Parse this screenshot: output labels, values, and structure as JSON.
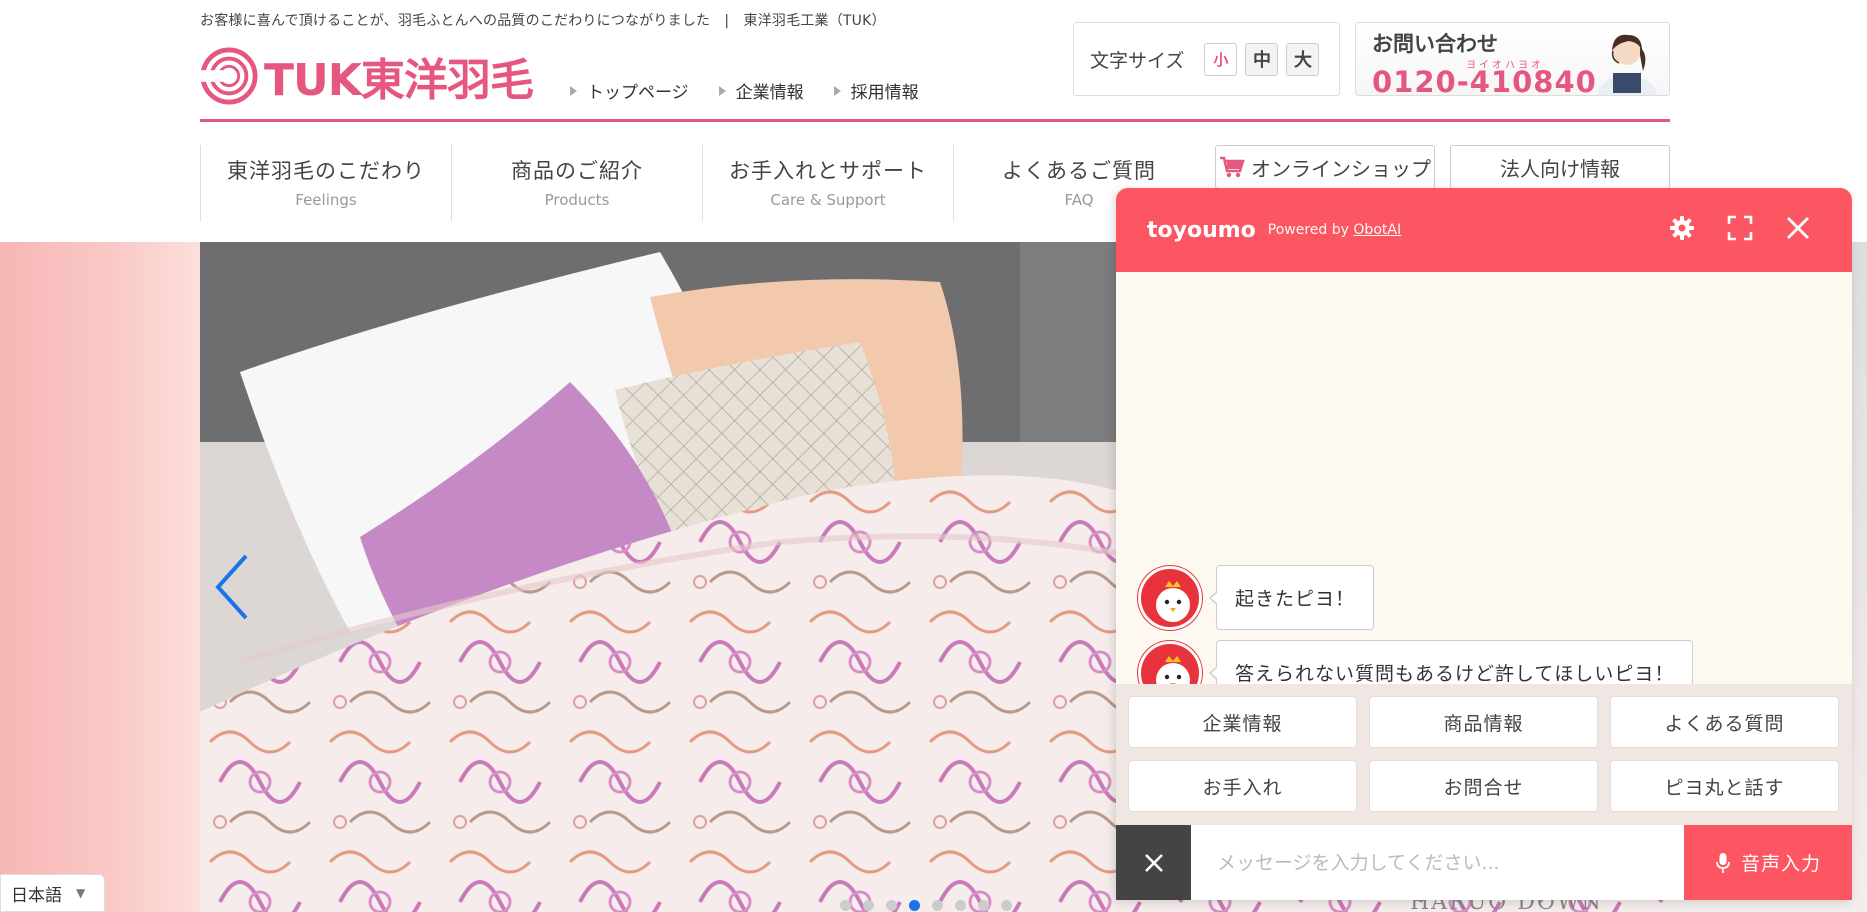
{
  "header": {
    "tagline": "お客様に喜んで頂けることが、羽毛ふとんへの品質のこだわりにつながりました　|　東洋羽毛工業（TUK）",
    "logo_text": "TUK東洋羽毛",
    "top_links": [
      "トップページ",
      "企業情報",
      "採用情報"
    ],
    "font_size": {
      "label": "文字サイズ",
      "options": [
        "小",
        "中",
        "大"
      ]
    },
    "contact": {
      "title": "お問い合わせ",
      "kana": "ヨイオハヨオ",
      "tel": "0120-410840"
    }
  },
  "nav": {
    "items": [
      {
        "jp": "東洋羽毛のこだわり",
        "en": "Feelings"
      },
      {
        "jp": "商品のご紹介",
        "en": "Products"
      },
      {
        "jp": "お手入れとサポート",
        "en": "Care & Support"
      },
      {
        "jp": "よくあるご質問",
        "en": "FAQ"
      }
    ],
    "shop": "オンラインショップ",
    "corporate": "法人向け情報"
  },
  "hero": {
    "watermark": "HARUO DOWN",
    "dots_count": 8,
    "active_dot": 3
  },
  "language": {
    "selected": "日本語"
  },
  "chat": {
    "brand": "toyoumo",
    "powered_prefix": "Powered by",
    "powered_link": "ObotAI",
    "messages": [
      "起きたピヨ！",
      "答えられない質問もあるけど許してほしいピヨ！"
    ],
    "quick_replies": [
      "企業情報",
      "商品情報",
      "よくある質問",
      "お手入れ",
      "お問合せ",
      "ピヨ丸と話す"
    ],
    "input_placeholder": "メッセージを入力してください...",
    "voice_label": "音声入力"
  },
  "colors": {
    "brand_pink": "#e5577f",
    "chat_red": "#fb5661",
    "active_dot": "#1a73e8"
  }
}
